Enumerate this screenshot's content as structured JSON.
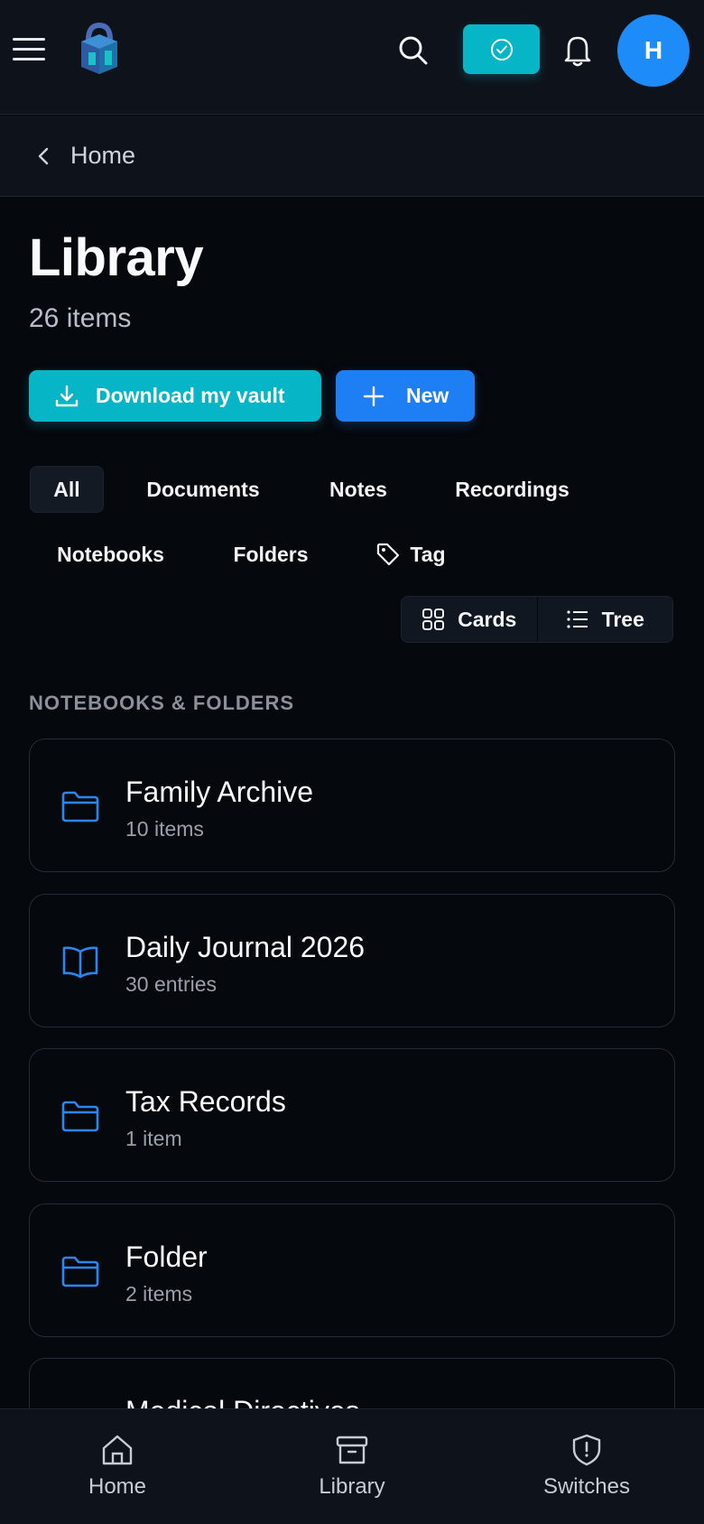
{
  "header": {
    "avatar_initial": "H"
  },
  "breadcrumb": {
    "label": "Home"
  },
  "page": {
    "title": "Library",
    "count": "26 items"
  },
  "actions": {
    "download_label": "Download my vault",
    "new_label": "New"
  },
  "filters": {
    "all": "All",
    "documents": "Documents",
    "notes": "Notes",
    "recordings": "Recordings",
    "notebooks": "Notebooks",
    "folders": "Folders",
    "tag": "Tag"
  },
  "view_toggle": {
    "cards": "Cards",
    "tree": "Tree"
  },
  "section": {
    "label": "NOTEBOOKS & FOLDERS"
  },
  "items": [
    {
      "title": "Family Archive",
      "sub": "10 items",
      "icon": "folder-icon"
    },
    {
      "title": "Daily Journal 2026",
      "sub": "30 entries",
      "icon": "book-open-icon"
    },
    {
      "title": "Tax Records",
      "sub": "1 item",
      "icon": "folder-icon"
    },
    {
      "title": "Folder",
      "sub": "2 items",
      "icon": "folder-icon"
    },
    {
      "title": "Medical Directives",
      "sub": "",
      "icon": "book-open-icon"
    }
  ],
  "bottom_nav": {
    "home": "Home",
    "library": "Library",
    "switches": "Switches"
  },
  "colors": {
    "accent_teal": "#06b6c6",
    "accent_blue": "#1d7ff3",
    "background": "#05080d"
  }
}
